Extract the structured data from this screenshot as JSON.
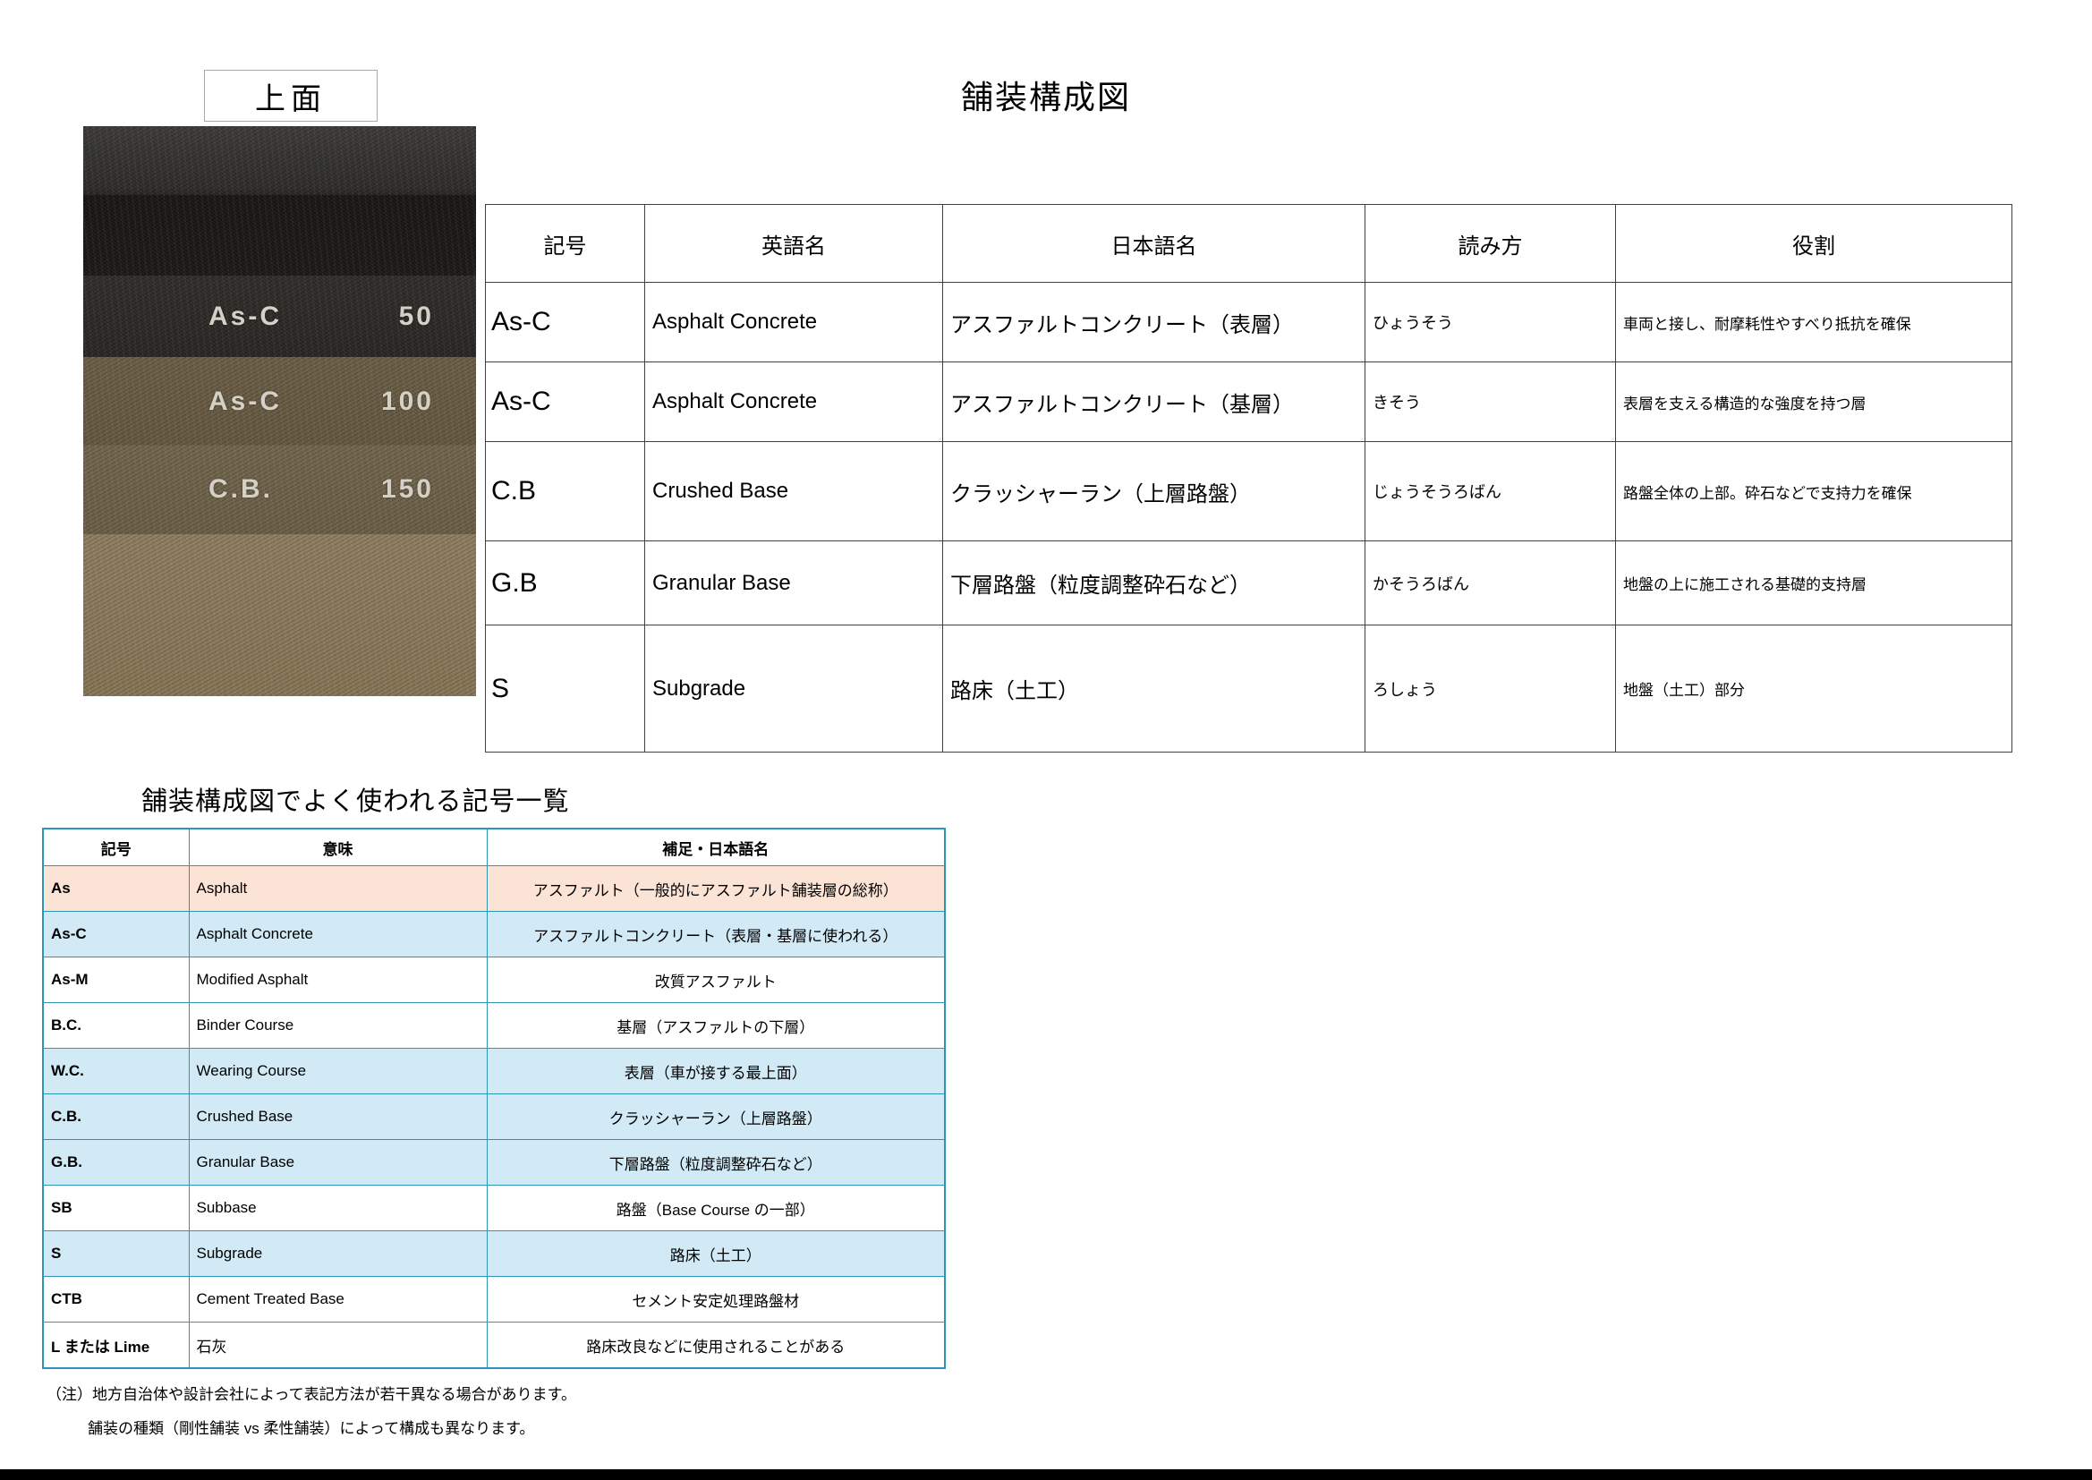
{
  "page": {
    "title": "舗装構成図",
    "surface_label": "上面",
    "notes": [
      "（注）地方自治体や設計会社によって表記方法が若干異なる場合があります。",
      "舗装の種類（剛性舗装 vs 柔性舗装）によって構成も異なります。"
    ]
  },
  "photo": {
    "layers": [
      {
        "symbol": "As-C",
        "thickness": "50"
      },
      {
        "symbol": "As-C",
        "thickness": "100"
      },
      {
        "symbol": "C.B.",
        "thickness": "150"
      }
    ]
  },
  "layer_table": {
    "headers": [
      "記号",
      "英語名",
      "日本語名",
      "読み方",
      "役割"
    ],
    "rows": [
      {
        "symbol": "As-C",
        "english": "Asphalt Concrete",
        "japanese": "アスファルトコンクリート（表層）",
        "reading": "ひょうそう",
        "role": "車両と接し、耐摩耗性やすべり抵抗を確保"
      },
      {
        "symbol": "As-C",
        "english": "Asphalt Concrete",
        "japanese": "アスファルトコンクリート（基層）",
        "reading": "きそう",
        "role": "表層を支える構造的な強度を持つ層"
      },
      {
        "symbol": "C.B",
        "english": "Crushed Base",
        "japanese": "クラッシャーラン（上層路盤）",
        "reading": "じょうそうろばん",
        "role": "路盤全体の上部。砕石などで支持力を確保"
      },
      {
        "symbol": "G.B",
        "english": "Granular Base",
        "japanese": "下層路盤（粒度調整砕石など）",
        "reading": "かそうろばん",
        "role": "地盤の上に施工される基礎的支持層"
      },
      {
        "symbol": "S",
        "english": "Subgrade",
        "japanese": "路床（土工）",
        "reading": "ろしょう",
        "role": "地盤（土工）部分"
      }
    ]
  },
  "symbol_section": {
    "heading": "舗装構成図でよく使われる記号一覧",
    "headers": [
      "記号",
      "意味",
      "補足・日本語名"
    ],
    "rows": [
      {
        "symbol": "As",
        "meaning": "Asphalt",
        "note": "アスファルト（一般的にアスファルト舗装層の総称）",
        "bg": "peach"
      },
      {
        "symbol": "As-C",
        "meaning": "Asphalt Concrete",
        "note": "アスファルトコンクリート（表層・基層に使われる）",
        "bg": "blue"
      },
      {
        "symbol": "As-M",
        "meaning": "Modified Asphalt",
        "note": "改質アスファルト",
        "bg": "white"
      },
      {
        "symbol": "B.C.",
        "meaning": "Binder Course",
        "note": "基層（アスファルトの下層）",
        "bg": "white"
      },
      {
        "symbol": "W.C.",
        "meaning": "Wearing Course",
        "note": "表層（車が接する最上面）",
        "bg": "blue"
      },
      {
        "symbol": "C.B.",
        "meaning": "Crushed Base",
        "note": "クラッシャーラン（上層路盤）",
        "bg": "blue"
      },
      {
        "symbol": "G.B.",
        "meaning": "Granular Base",
        "note": "下層路盤（粒度調整砕石など）",
        "bg": "blue"
      },
      {
        "symbol": "SB",
        "meaning": "Subbase",
        "note": "路盤（Base Course の一部）",
        "bg": "white"
      },
      {
        "symbol": "S",
        "meaning": "Subgrade",
        "note": "路床（土工）",
        "bg": "blue"
      },
      {
        "symbol": "CTB",
        "meaning": "Cement Treated Base",
        "note": "セメント安定処理路盤材",
        "bg": "white"
      },
      {
        "symbol": "L または Lime",
        "meaning": "石灰",
        "note": "路床改良などに使用されることがある",
        "bg": "white"
      }
    ]
  },
  "colors": {
    "symbol_table_border": "#2e96b4",
    "row_peach": "#fbe3d5",
    "row_blue": "#d2eaf6",
    "layer_table_border": "#404040",
    "bottom_bar": "#000000"
  }
}
